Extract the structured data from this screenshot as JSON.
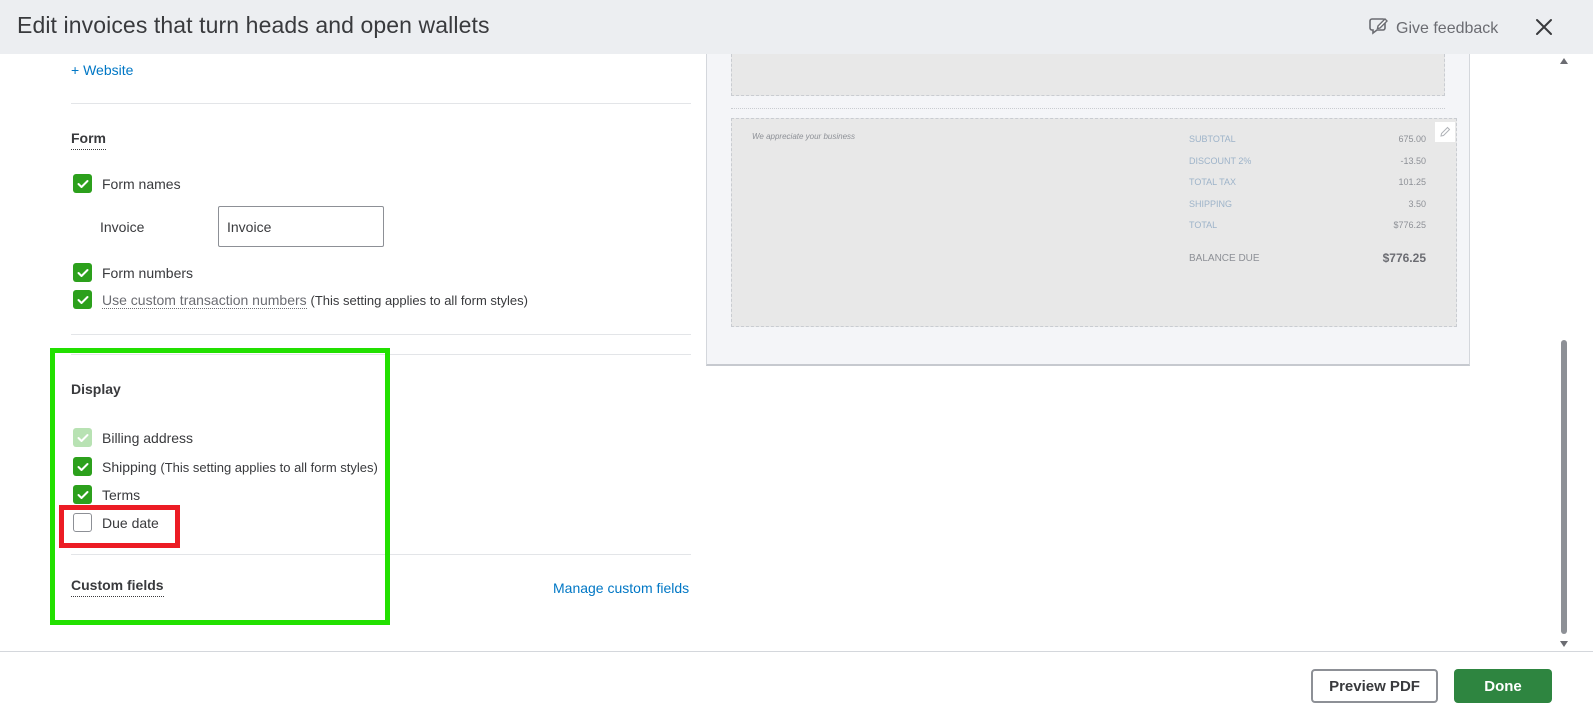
{
  "header": {
    "title": "Edit invoices that turn heads and open wallets",
    "feedback_label": "Give feedback"
  },
  "content": {
    "website_link": "+ Website",
    "form_section": {
      "title": "Form",
      "form_names_label": "Form names",
      "invoice_label": "Invoice",
      "invoice_value": "Invoice",
      "form_numbers_label": "Form numbers",
      "custom_numbers_link": "Use custom transaction numbers",
      "custom_numbers_note": "(This setting applies to all form styles)"
    },
    "display_section": {
      "title": "Display",
      "billing_label": "Billing address",
      "shipping_label": "Shipping",
      "shipping_note": "(This setting applies to all form styles)",
      "terms_label": "Terms",
      "due_date_label": "Due date"
    },
    "custom_fields": {
      "title": "Custom fields",
      "manage_link": "Manage custom fields"
    }
  },
  "preview": {
    "thanks_text": "We appreciate your business",
    "summary": [
      {
        "label": "SUBTOTAL",
        "value": "675.00"
      },
      {
        "label": "DISCOUNT 2%",
        "value": "-13.50"
      },
      {
        "label": "TOTAL TAX",
        "value": "101.25"
      },
      {
        "label": "SHIPPING",
        "value": "3.50"
      },
      {
        "label": "TOTAL",
        "value": "$776.25"
      }
    ],
    "balance_label": "BALANCE DUE",
    "balance_value": "$776.25"
  },
  "footer": {
    "preview_pdf_label": "Preview PDF",
    "done_label": "Done"
  },
  "colors": {
    "accent_green": "#2ca01c",
    "done_button": "#2e8540",
    "link_blue": "#0077c5",
    "highlight_green": "#22e000",
    "highlight_red": "#ec1c24"
  }
}
